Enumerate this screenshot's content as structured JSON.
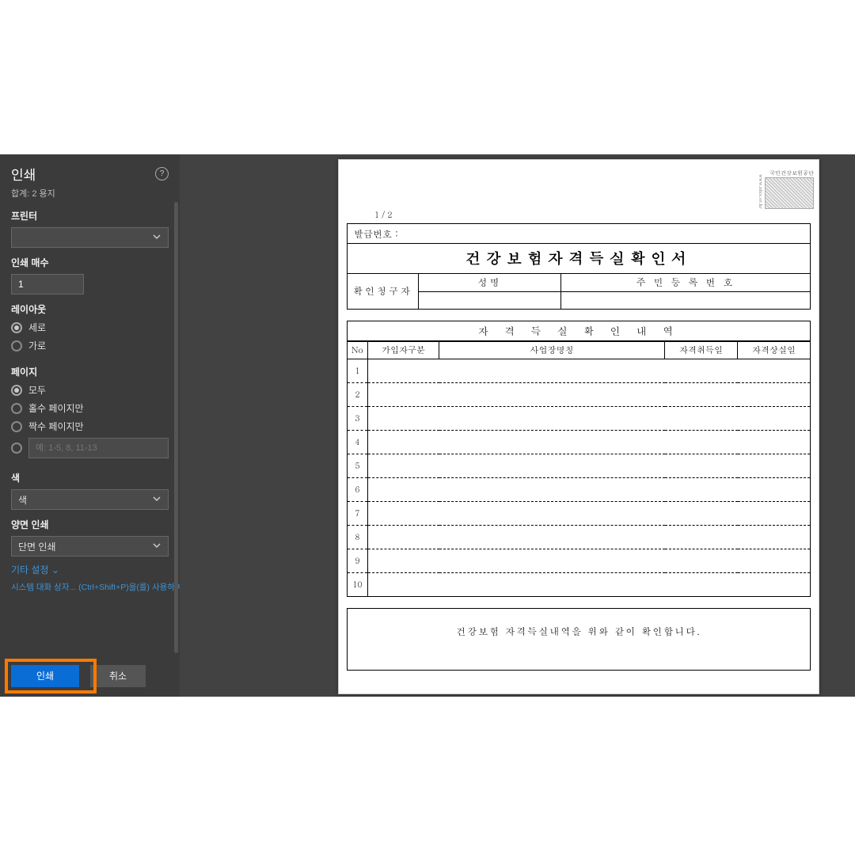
{
  "sidebar": {
    "title": "인쇄",
    "help": "?",
    "total": "합계: 2 용지",
    "printer_label": "프린터",
    "printer_value": "",
    "copies_label": "인쇄 매수",
    "copies_value": "1",
    "layout_label": "레이아웃",
    "layout_portrait": "세로",
    "layout_landscape": "가로",
    "pages_label": "페이지",
    "pages_all": "모두",
    "pages_odd": "홀수 페이지만",
    "pages_even": "짝수 페이지만",
    "pages_custom_ph": "예: 1-5, 8, 11-13",
    "color_label": "색",
    "color_value": "색",
    "duplex_label": "양면 인쇄",
    "duplex_value": "단면 인쇄",
    "more": "기타 설정",
    "tip": "시스템 대화 상자... (Ctrl+Shift+P)을(를) 사용하여",
    "btn_print": "인쇄",
    "btn_cancel": "취소"
  },
  "preview": {
    "page_indicator": "1 / 2",
    "stamp_text": "국민건강보험공단",
    "stamp_side": "www.nhis.or.kr",
    "issue_label": "발급번호 :",
    "doc_title": "건강보험자격득실확인서",
    "requester_label": "확인청구자",
    "name_label": "성명",
    "rrn_label": "주 민 등 록 번 호",
    "history_title": "자 격 득 실 확 인 내 역",
    "cols": {
      "no": "No",
      "a": "가입자구분",
      "b": "사업장명칭",
      "c": "자격취득일",
      "d": "자격상실일"
    },
    "rows": [
      "1",
      "2",
      "3",
      "4",
      "5",
      "6",
      "7",
      "8",
      "9",
      "10"
    ],
    "confirm_text": "건강보험 자격득실내역을 위와 같이 확인합니다."
  }
}
